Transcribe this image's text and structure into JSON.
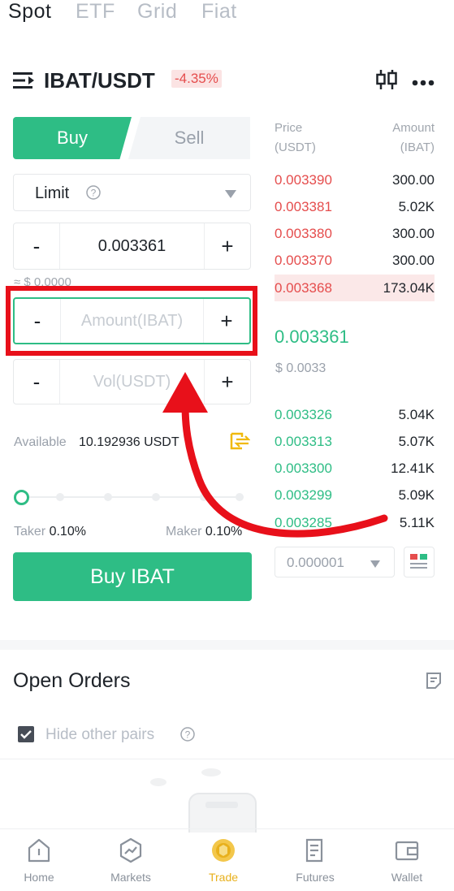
{
  "top_tabs": [
    "Spot",
    "ETF",
    "Grid",
    "Fiat"
  ],
  "header": {
    "pair": "IBAT/USDT",
    "change": "-4.35%"
  },
  "order": {
    "buy_label": "Buy",
    "sell_label": "Sell",
    "order_type": "Limit",
    "price_value": "0.003361",
    "price_usd": "≈ $ 0.0000",
    "amount_placeholder": "Amount(IBAT)",
    "vol_placeholder": "Vol(USDT)",
    "minus": "-",
    "plus": "+",
    "available_label": "Available",
    "available_value": "10.192936 USDT",
    "taker_label": "Taker",
    "taker_value": "0.10%",
    "maker_label": "Maker",
    "maker_value": "0.10%",
    "submit_label": "Buy IBAT",
    "slider_percent": 0
  },
  "orderbook": {
    "price_header": "Price",
    "price_unit": "(USDT)",
    "amount_header": "Amount",
    "amount_unit": "(IBAT)",
    "asks": [
      {
        "price": "0.003390",
        "amount": "300.00"
      },
      {
        "price": "0.003381",
        "amount": "5.02K"
      },
      {
        "price": "0.003380",
        "amount": "300.00"
      },
      {
        "price": "0.003370",
        "amount": "300.00"
      },
      {
        "price": "0.003368",
        "amount": "173.04K"
      }
    ],
    "last_price": "0.003361",
    "last_price_usd": "$ 0.0033",
    "bids": [
      {
        "price": "0.003326",
        "amount": "5.04K"
      },
      {
        "price": "0.003313",
        "amount": "5.07K"
      },
      {
        "price": "0.003300",
        "amount": "12.41K"
      },
      {
        "price": "0.003299",
        "amount": "5.09K"
      },
      {
        "price": "0.003285",
        "amount": "5.11K"
      }
    ],
    "precision": "0.000001"
  },
  "open_orders": {
    "title": "Open Orders",
    "hide_pairs_label": "Hide other pairs",
    "hide_pairs_checked": true
  },
  "bottom_nav": [
    "Home",
    "Markets",
    "Trade",
    "Futures",
    "Wallet"
  ],
  "colors": {
    "green": "#2ebd85",
    "red": "#e54d4d",
    "highlight": "#e8101a",
    "nav_active": "#e8b01c"
  }
}
